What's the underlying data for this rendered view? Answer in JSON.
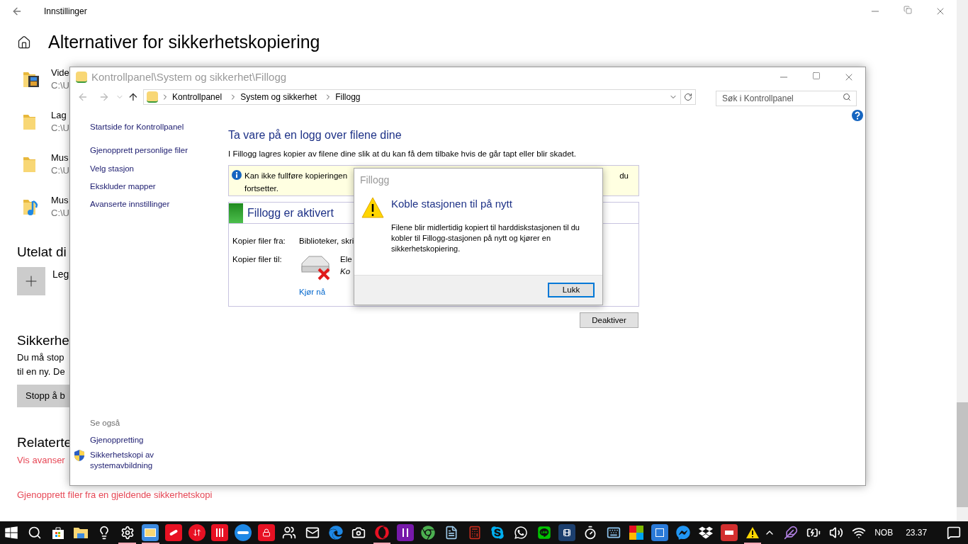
{
  "settings": {
    "title": "Innstillinger",
    "heading": "Alternativer for sikkerhetskopiering",
    "folders": [
      {
        "kind": "video",
        "name": "Vide",
        "path": "C:\\U"
      },
      {
        "kind": "plain",
        "name": "Lag",
        "path": "C:\\U"
      },
      {
        "kind": "plain",
        "name": "Mus",
        "path": "C:\\U"
      },
      {
        "kind": "music",
        "name": "Mus",
        "path": "C:\\U"
      }
    ],
    "excluded": {
      "heading": "Utelat di",
      "add_label": "Leg"
    },
    "backup": {
      "heading": "Sikkerhe",
      "lines": [
        "Du må stop",
        "til en ny. De"
      ],
      "button": "Stopp å b"
    },
    "related": {
      "heading": "Relaterte",
      "links": [
        "Vis avanser",
        "Gjenopprett filer fra en gjeldende sikkerhetskopi"
      ]
    }
  },
  "control_panel": {
    "title": "Kontrollpanel\\System og sikkerhet\\Fillogg",
    "breadcrumb": [
      "Kontrollpanel",
      "System og sikkerhet",
      "Fillogg"
    ],
    "search": {
      "placeholder": "Søk i Kontrollpanel"
    },
    "sidebar": {
      "home": "Startside for Kontrollpanel",
      "links": [
        "Gjenopprett personlige filer",
        "Velg stasjon",
        "Ekskluder mapper",
        "Avanserte innstillinger"
      ]
    },
    "see_also": {
      "heading": "Se også",
      "links": [
        {
          "label": "Gjenoppretting",
          "shield": false
        },
        {
          "label": "Sikkerhetskopi av systemavbildning",
          "shield": true
        }
      ]
    },
    "heading": "Ta vare på en logg over filene dine",
    "description": "I Fillogg lagres kopier av filene dine slik at du kan få dem tilbake hvis de går tapt eller blir skadet.",
    "info_bar": {
      "line_1": "Kan ikke fullføre kopieringen",
      "tail": "du",
      "line_2": "fortsetter."
    },
    "status": {
      "title": "Fillogg er aktivert",
      "active": true
    },
    "copy_from": {
      "label": "Kopier filer fra:",
      "value": "Biblioteker, skri"
    },
    "copy_to": {
      "label": "Kopier filer til:",
      "drive_name": "Ele",
      "drive_status": "Ko",
      "disconnected": true
    },
    "run_now": "Kjør nå",
    "deactivate": "Deaktiver"
  },
  "dialog": {
    "title": "Fillogg",
    "heading": "Koble stasjonen til på nytt",
    "message": "Filene blir midlertidig kopiert til harddiskstasjonen til du kobler til Fillogg-stasjonen på nytt og kjører en sikkerhetskopiering.",
    "button": "Lukk"
  },
  "taskbar": {
    "apps": [
      {
        "kind": "start",
        "running": false
      },
      {
        "kind": "search",
        "running": false
      },
      {
        "kind": "store",
        "running": false
      },
      {
        "kind": "folder",
        "running": false
      },
      {
        "kind": "bulb",
        "running": false
      },
      {
        "kind": "gear",
        "running": true
      },
      {
        "kind": "panel",
        "running": true
      },
      {
        "kind": "red-app",
        "running": false
      },
      {
        "kind": "red-circle",
        "running": false
      },
      {
        "kind": "red-bars",
        "running": false
      },
      {
        "kind": "blue-circle",
        "running": false
      },
      {
        "kind": "lock",
        "running": false
      },
      {
        "kind": "people",
        "running": false
      },
      {
        "kind": "mail",
        "running": false
      },
      {
        "kind": "edge",
        "running": false
      },
      {
        "kind": "camera",
        "running": false
      },
      {
        "kind": "opera",
        "running": true
      },
      {
        "kind": "onenote",
        "running": false
      },
      {
        "kind": "chrome",
        "running": false
      },
      {
        "kind": "notepad",
        "running": false
      },
      {
        "kind": "calculator",
        "running": false
      },
      {
        "kind": "skype",
        "running": false
      },
      {
        "kind": "whatsapp",
        "running": false
      },
      {
        "kind": "chat",
        "running": false
      },
      {
        "kind": "film",
        "running": false
      },
      {
        "kind": "timer",
        "running": false
      },
      {
        "kind": "keyboard",
        "running": false
      },
      {
        "kind": "colors",
        "running": false
      },
      {
        "kind": "blue-app",
        "running": false
      },
      {
        "kind": "messenger",
        "running": false
      },
      {
        "kind": "dropbox",
        "running": false
      },
      {
        "kind": "pdf",
        "running": false
      },
      {
        "kind": "warning",
        "running": true
      }
    ],
    "language": "NOB",
    "time": "23.37"
  }
}
